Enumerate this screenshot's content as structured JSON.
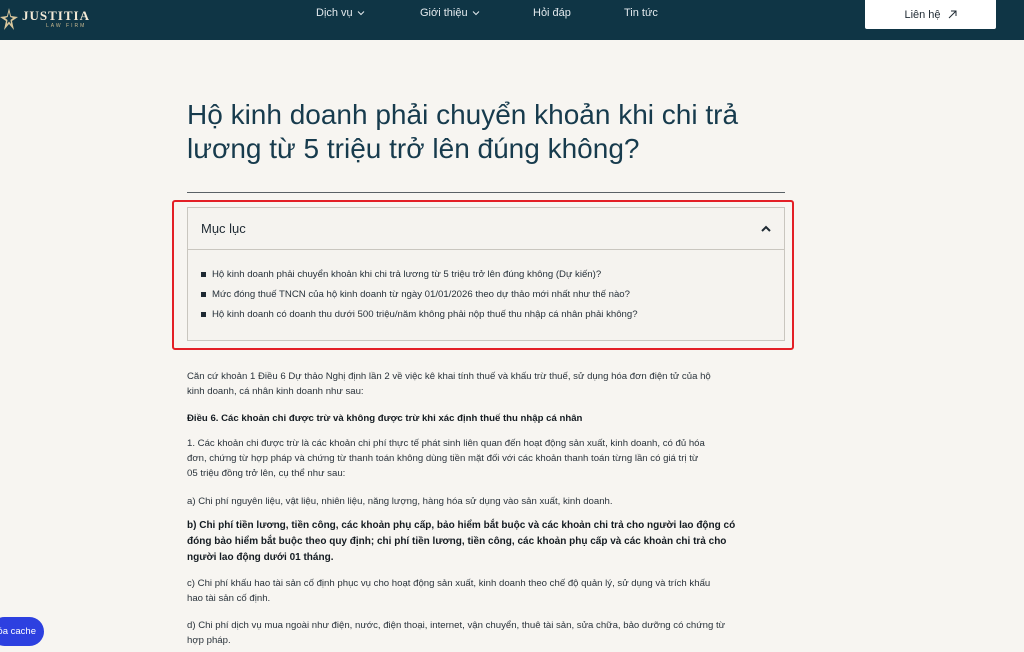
{
  "header": {
    "logo_text": "JUSTITIA",
    "logo_sub": "LAW FIRM",
    "nav": [
      {
        "label": "Dịch vụ",
        "has_dropdown": true
      },
      {
        "label": "Giới thiệu",
        "has_dropdown": true
      },
      {
        "label": "Hỏi đáp",
        "has_dropdown": false
      },
      {
        "label": "Tin tức",
        "has_dropdown": false
      }
    ],
    "contact_label": "Liên hệ"
  },
  "article": {
    "title_line1": "Hộ kinh doanh phải chuyển khoản khi chi trả",
    "title_line2": "lương từ 5 triệu trở lên đúng không?",
    "toc": {
      "title": "Mục lục",
      "items": [
        "Hộ kinh doanh phải chuyển khoản khi chi trả lương từ 5 triệu trở lên đúng không (Dự kiến)?",
        "Mức đóng thuế TNCN của hộ kinh doanh từ ngày 01/01/2026 theo dự thảo mới nhất như thế nào?",
        "Hộ kinh doanh có doanh thu dưới 500 triệu/năm không phải nộp thuế thu nhập cá nhân phải không?"
      ]
    },
    "paragraphs": {
      "p1_l1": "Căn cứ khoản 1 Điều 6 Dự thảo Nghị định lần 2 về việc kê khai tính thuế và khấu trừ thuế, sử dụng hóa đơn điện tử của hộ",
      "p1_l2": "kinh doanh, cá nhân kinh doanh như sau:",
      "p2": "Điều 6. Các khoản chi được trừ và không được trừ khi xác định thuế thu nhập cá nhân",
      "p3_l1": "1. Các khoản chi được trừ là các khoản chi phí thực tế phát sinh liên quan đến hoạt động sản xuất, kinh doanh, có đủ hóa",
      "p3_l2": "đơn, chứng từ hợp pháp và chứng từ thanh toán không dùng tiền mặt đối với các khoản thanh toán từng lần có giá trị từ",
      "p3_l3": "05 triệu đồng trở lên, cụ thể như sau:",
      "p4": "a) Chi phí nguyên liệu, vật liệu, nhiên liệu, năng lượng, hàng hóa sử dụng vào sản xuất, kinh doanh.",
      "p5_l1": "b) Chi phí tiền lương, tiền công, các khoản phụ cấp, bảo hiểm bắt buộc và các khoản chi trả cho người lao động có",
      "p5_l2": "đóng bảo hiểm bắt buộc theo quy định; chi phí tiền lương, tiền công, các khoản phụ cấp và các khoản chi trả cho",
      "p5_l3": "người lao động dưới 01 tháng.",
      "p6_l1": "c) Chi phí khấu hao tài sản cố định phục vụ cho hoạt động sản xuất, kinh doanh theo chế độ quản lý, sử dụng và trích khấu",
      "p6_l2": "hao tài sản cố định.",
      "p7_l1": "d) Chi phí dịch vụ mua ngoài như điện, nước, điện thoại, internet, vận chuyển, thuê tài sản, sửa chữa, bảo dưỡng có chứng từ",
      "p7_l2": "hợp pháp."
    }
  },
  "floating": {
    "cache_label": "Xóa cache"
  },
  "colors": {
    "header_bg": "#0f3545",
    "page_bg": "#f7f5f1",
    "highlight": "#e31f26",
    "cache_button": "#2d40e0"
  }
}
